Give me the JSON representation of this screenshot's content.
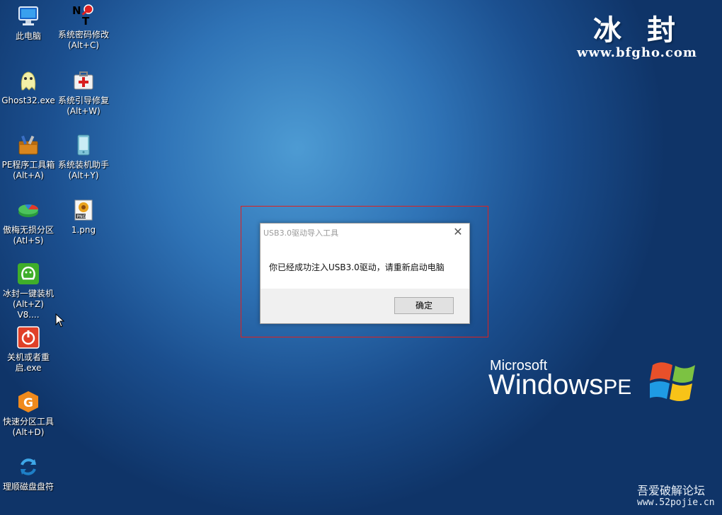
{
  "desktop": {
    "icons": [
      {
        "label": "此电脑",
        "icon": "computer-icon"
      },
      {
        "label": "系统密码修改\n(Alt+C)",
        "icon": "password-key-icon"
      },
      {
        "label": "Ghost32.exe",
        "icon": "ghost-icon"
      },
      {
        "label": "系统引导修复\n(Alt+W)",
        "icon": "first-aid-kit-icon"
      },
      {
        "label": "PE程序工具箱\n(Alt+A)",
        "icon": "toolbox-icon"
      },
      {
        "label": "系统装机助手\n(Alt+Y)",
        "icon": "install-assistant-icon"
      },
      {
        "label": "傲梅无损分区\n(Atl+S)",
        "icon": "partition-icon"
      },
      {
        "label": "1.png",
        "icon": "png-file-icon"
      },
      {
        "label": "冰封一键装机\n(Alt+Z) V8....",
        "icon": "bingfeng-install-icon"
      },
      {
        "label": "关机或者重\n启.exe",
        "icon": "power-icon"
      },
      {
        "label": "快速分区工具\n(Alt+D)",
        "icon": "diskgenius-icon"
      },
      {
        "label": "理顺磁盘盘符",
        "icon": "refresh-disk-icon"
      }
    ]
  },
  "brand": {
    "title": "冰封",
    "url": "www.bfgho.com"
  },
  "windows_logo": {
    "microsoft": "Microsoft",
    "windows": "Windows",
    "pe": "PE"
  },
  "watermark": {
    "name": "吾爱破解论坛",
    "url": "www.52pojie.cn"
  },
  "dialog": {
    "title": "USB3.0驱动导入工具",
    "close": "✕",
    "message": "你已经成功注入USB3.0驱动，请重新启动电脑",
    "ok_label": "确定"
  },
  "colors": {
    "desktop_bg": "#2f73b6",
    "highlight_border": "#e0201e",
    "dialog_footer": "#f0f0f0"
  }
}
